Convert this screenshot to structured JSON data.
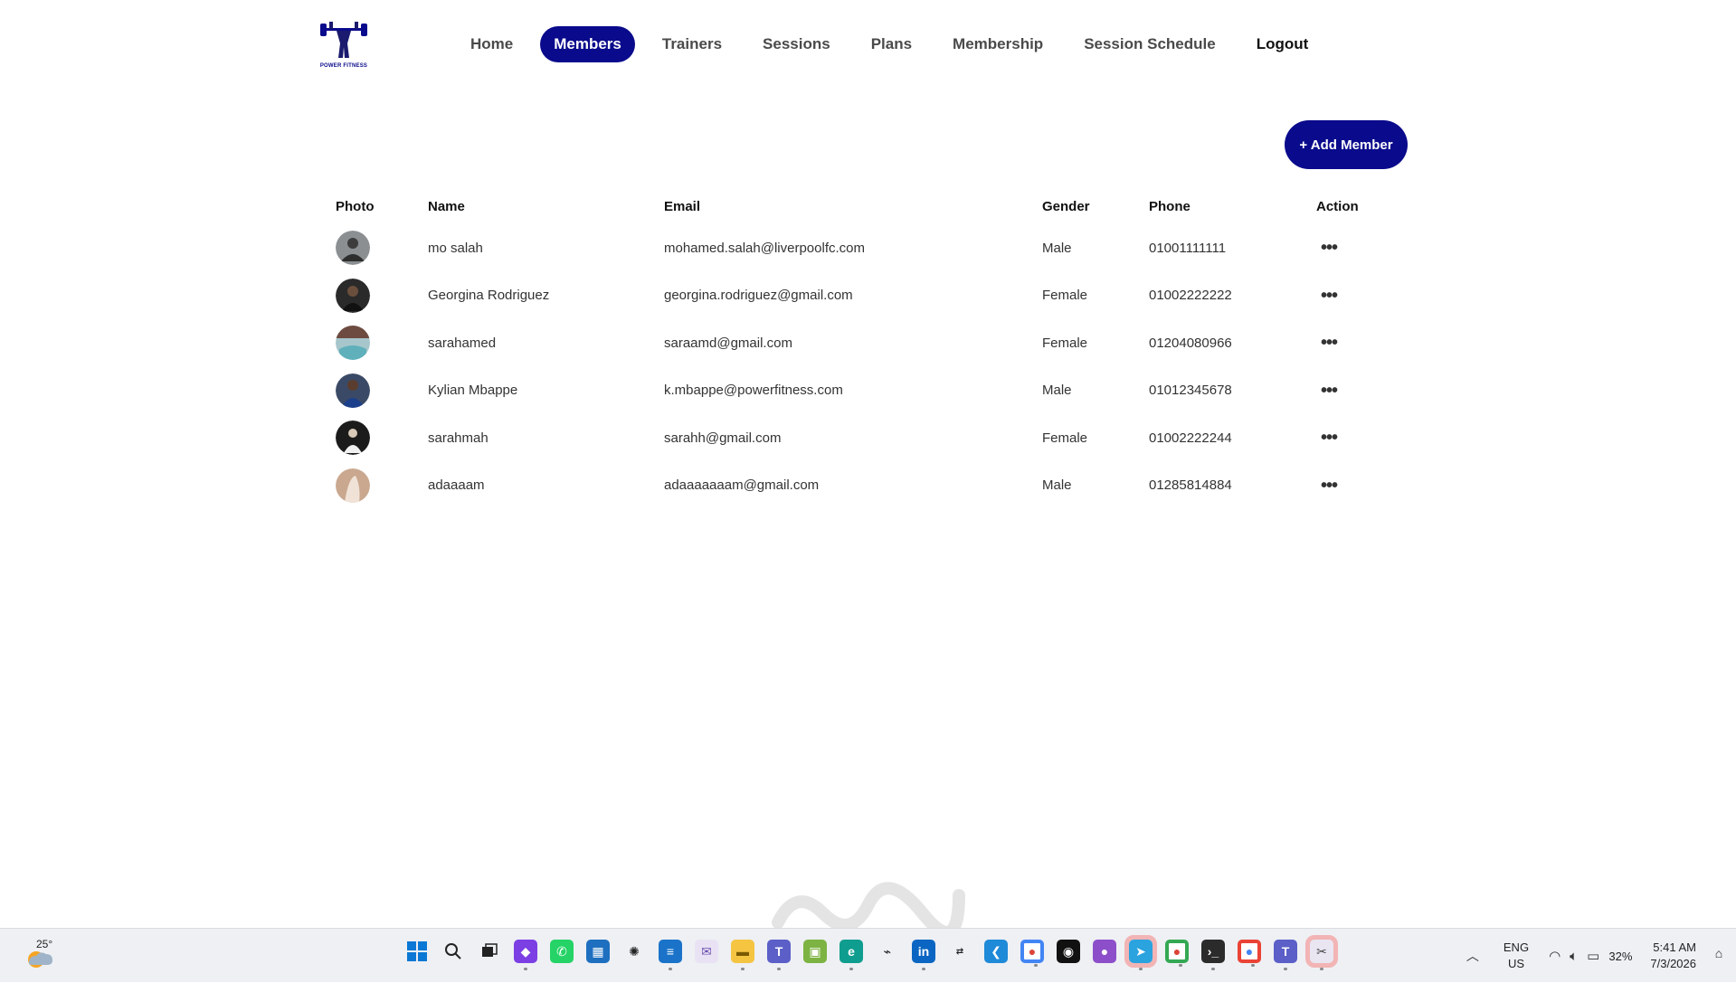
{
  "brand": {
    "logo_text": "POWER FITNESS"
  },
  "nav": {
    "items": [
      {
        "label": "Home",
        "active": false
      },
      {
        "label": "Members",
        "active": true
      },
      {
        "label": "Trainers",
        "active": false
      },
      {
        "label": "Sessions",
        "active": false
      },
      {
        "label": "Plans",
        "active": false
      },
      {
        "label": "Membership",
        "active": false
      },
      {
        "label": "Session Schedule",
        "active": false
      }
    ],
    "logout_label": "Logout"
  },
  "actions": {
    "add_member_label": "+ Add Member"
  },
  "table": {
    "headers": {
      "photo": "Photo",
      "name": "Name",
      "email": "Email",
      "gender": "Gender",
      "phone": "Phone",
      "action": "Action"
    },
    "rows": [
      {
        "name": "mo salah",
        "email": "mohamed.salah@liverpoolfc.com",
        "gender": "Male",
        "phone": "01001111111",
        "action": "•••"
      },
      {
        "name": "Georgina Rodriguez",
        "email": "georgina.rodriguez@gmail.com",
        "gender": "Female",
        "phone": "01002222222",
        "action": "•••"
      },
      {
        "name": "sarahamed",
        "email": "saraamd@gmail.com",
        "gender": "Female",
        "phone": "01204080966",
        "action": "•••"
      },
      {
        "name": "Kylian Mbappe",
        "email": "k.mbappe@powerfitness.com",
        "gender": "Male",
        "phone": "01012345678",
        "action": "•••"
      },
      {
        "name": "sarahmah",
        "email": "sarahh@gmail.com",
        "gender": "Female",
        "phone": "01002222244",
        "action": "•••"
      },
      {
        "name": "adaaaam",
        "email": "adaaaaaaam@gmail.com",
        "gender": "Male",
        "phone": "01285814884",
        "action": "•••"
      }
    ]
  },
  "colors": {
    "primary": "#0a0a8c"
  },
  "taskbar": {
    "temperature": "25°",
    "language": "ENG",
    "region": "US",
    "battery": "32%",
    "time": "5:41 AM",
    "date": "7/3/2026"
  }
}
